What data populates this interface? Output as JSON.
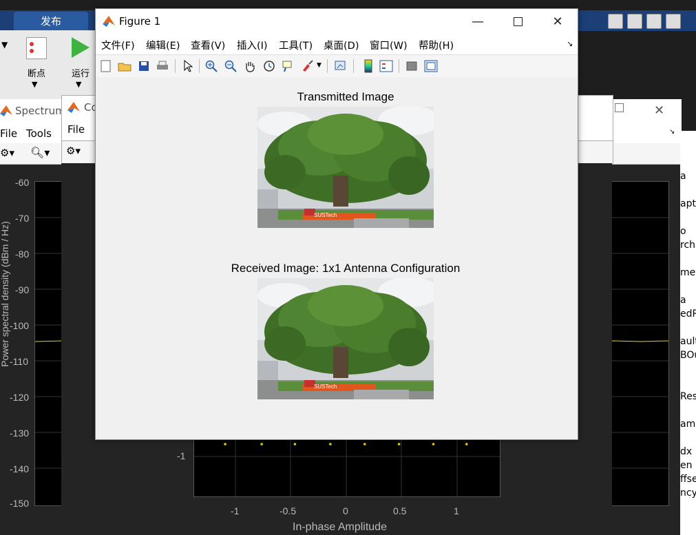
{
  "ribbon": {
    "tab_publish": "发布",
    "breakpoint_label": "断点",
    "run_label": "运行"
  },
  "spectrum_window": {
    "title": "Spectrum",
    "menu": [
      "File",
      "Tools"
    ],
    "ylabel": "Power spectral density (dBm / Hz)",
    "y_ticks": [
      "-60",
      "-70",
      "-80",
      "-90",
      "-100",
      "-110",
      "-120",
      "-130",
      "-140",
      "-150"
    ]
  },
  "constellation_window": {
    "title": "Co",
    "menu_file": "File",
    "y_tick": "-1",
    "x_ticks": [
      "-1",
      "-0.5",
      "0",
      "0.5",
      "1"
    ],
    "xlabel": "In-phase Amplitude"
  },
  "side_panel": {
    "items": [
      "a",
      "aptu",
      "o",
      "rch",
      "me",
      "a",
      "edR",
      "ault",
      "BOu",
      "Resi",
      "ame",
      "dx",
      "en",
      "ffse",
      "ncyO"
    ]
  },
  "figure": {
    "title": "Figure 1",
    "menu": [
      "文件(F)",
      "编辑(E)",
      "查看(V)",
      "插入(I)",
      "工具(T)",
      "桌面(D)",
      "窗口(W)",
      "帮助(H)"
    ],
    "transmitted_title": "Transmitted Image",
    "received_title": "Received Image: 1x1 Antenna Configuration",
    "logo_text": "SUSTech"
  },
  "colors": {
    "trace": "#e8d800",
    "plot_bg": "#000000",
    "ribbon_blue": "#1c3f78"
  },
  "constellation_points": {
    "type": "scatter",
    "x": [
      -1.1,
      -0.77,
      -0.47,
      -0.15,
      0.16,
      0.47,
      0.78,
      1.08
    ],
    "y": [
      -1.1,
      -1.1,
      -1.1,
      -1.1,
      -1.1,
      -1.1,
      -1.1,
      -1.1
    ]
  }
}
